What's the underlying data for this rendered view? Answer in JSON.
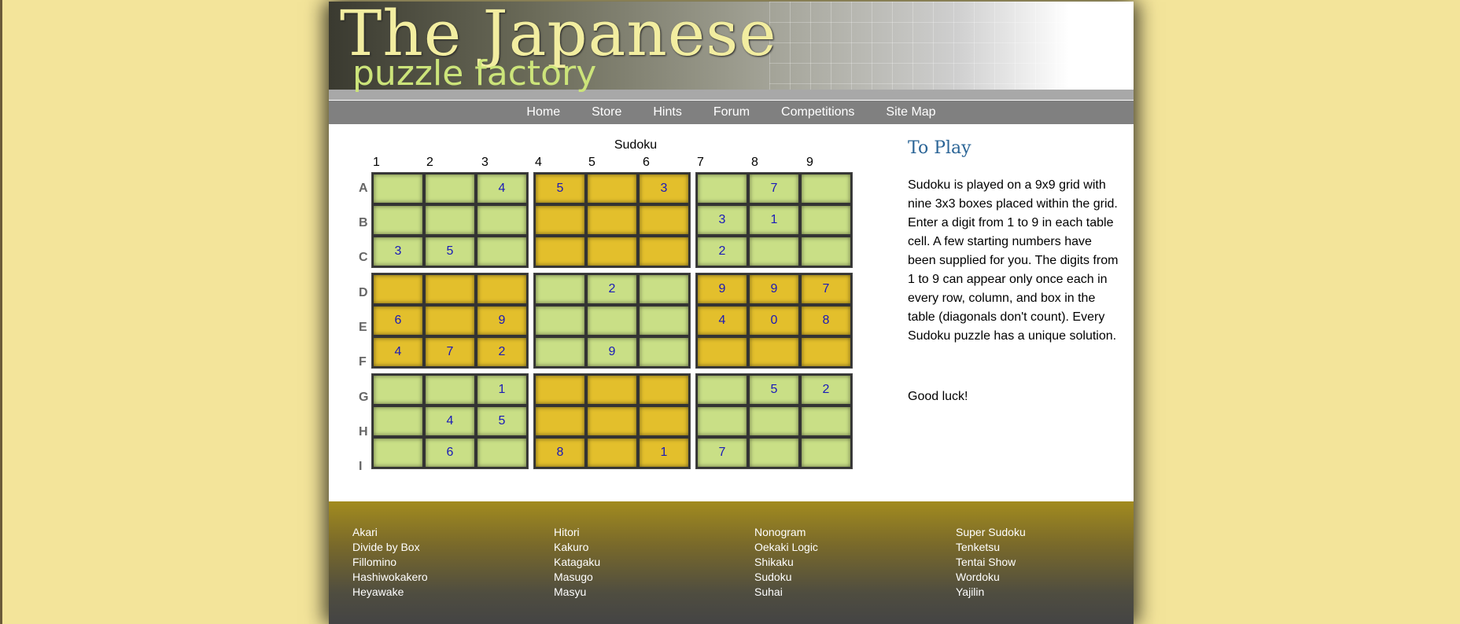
{
  "banner": {
    "title": "The Japanese",
    "subtitle": "puzzle factory"
  },
  "nav": {
    "items": [
      "Home",
      "Store",
      "Hints",
      "Forum",
      "Competitions",
      "Site Map"
    ]
  },
  "puzzle": {
    "title": "Sudoku",
    "columns": [
      "1",
      "2",
      "3",
      "4",
      "5",
      "6",
      "7",
      "8",
      "9"
    ],
    "rows": [
      "A",
      "B",
      "C",
      "D",
      "E",
      "F",
      "G",
      "H",
      "I"
    ],
    "cells": [
      [
        "",
        "",
        "4",
        "5",
        "",
        "3",
        "",
        "7",
        ""
      ],
      [
        "",
        "",
        "",
        "",
        "",
        "",
        "3",
        "1",
        ""
      ],
      [
        "3",
        "5",
        "",
        "",
        "",
        "",
        "2",
        "",
        ""
      ],
      [
        "",
        "",
        "",
        "",
        "2",
        "",
        "9",
        "9",
        "7"
      ],
      [
        "6",
        "",
        "9",
        "",
        "",
        "",
        "4",
        "0",
        "8"
      ],
      [
        "4",
        "7",
        "2",
        "",
        "9",
        "",
        "",
        "",
        ""
      ],
      [
        "",
        "",
        "1",
        "",
        "",
        "",
        "",
        "5",
        "2"
      ],
      [
        "",
        "4",
        "5",
        "",
        "",
        "",
        "",
        "",
        ""
      ],
      [
        "",
        "6",
        "",
        "8",
        "",
        "1",
        "7",
        "",
        ""
      ]
    ],
    "box_colors": [
      [
        "green",
        "gold",
        "green"
      ],
      [
        "gold",
        "green",
        "gold"
      ],
      [
        "green",
        "gold",
        "green"
      ]
    ],
    "colors": {
      "green": "#c9df86",
      "gold": "#e3bf2c",
      "digit": "#1a1ab8"
    }
  },
  "panel": {
    "title": "To Play",
    "text": "Sudoku is played on a 9x9 grid with nine 3x3 boxes placed within the grid. Enter a digit from 1 to 9 in each table cell. A few starting numbers have been supplied for you. The digits from 1 to 9 can appear only once each in every row, column, and box in the table (diagonals don't count). Every Sudoku puzzle has a unique solution.",
    "closing": "Good luck!"
  },
  "footer": {
    "columns": [
      [
        "Akari",
        "Divide by Box",
        "Fillomino",
        "Hashiwokakero",
        "Heyawake"
      ],
      [
        "Hitori",
        "Kakuro",
        "Katagaku",
        "Masugo",
        "Masyu"
      ],
      [
        "Nonogram",
        "Oekaki Logic",
        "Shikaku",
        "Sudoku",
        "Suhai"
      ],
      [
        "Super Sudoku",
        "Tenketsu",
        "Tentai Show",
        "Wordoku",
        "Yajilin"
      ]
    ]
  }
}
